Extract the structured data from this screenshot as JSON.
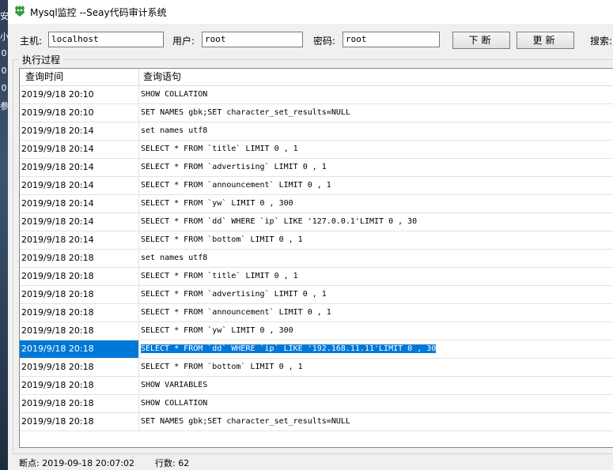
{
  "desktop": {
    "left_chars": [
      "安",
      "小",
      "0",
      "0",
      "0",
      "参"
    ]
  },
  "window": {
    "title": "Mysql监控 --Seay代码审计系统"
  },
  "connection": {
    "host_label": "主机:",
    "host_value": "localhost",
    "user_label": "用户:",
    "user_value": "root",
    "password_label": "密码:",
    "password_value": "root",
    "breakpoint_button": "下断",
    "refresh_button": "更新",
    "search_label": "搜索:"
  },
  "log": {
    "group_title": "执行过程",
    "columns": [
      "查询时间",
      "查询语句"
    ],
    "rows": [
      {
        "time": "2019/9/18 20:10",
        "query": "SHOW COLLATION"
      },
      {
        "time": "2019/9/18 20:10",
        "query": "SET NAMES gbk;SET character_set_results=NULL"
      },
      {
        "time": "2019/9/18 20:14",
        "query": "set names utf8"
      },
      {
        "time": "2019/9/18 20:14",
        "query": "SELECT * FROM  `title` LIMIT 0 , 1"
      },
      {
        "time": "2019/9/18 20:14",
        "query": "SELECT * FROM  `advertising` LIMIT 0 , 1"
      },
      {
        "time": "2019/9/18 20:14",
        "query": "SELECT * FROM  `announcement` LIMIT 0 , 1"
      },
      {
        "time": "2019/9/18 20:14",
        "query": "SELECT * FROM  `yw` LIMIT 0 , 300"
      },
      {
        "time": "2019/9/18 20:14",
        "query": "SELECT * FROM  `dd` WHERE  `ip` LIKE  '127.0.0.1'LIMIT 0 , 30"
      },
      {
        "time": "2019/9/18 20:14",
        "query": "SELECT * FROM  `bottom` LIMIT 0 , 1"
      },
      {
        "time": "2019/9/18 20:18",
        "query": "set names utf8"
      },
      {
        "time": "2019/9/18 20:18",
        "query": "SELECT * FROM  `title` LIMIT 0 , 1"
      },
      {
        "time": "2019/9/18 20:18",
        "query": "SELECT * FROM  `advertising` LIMIT 0 , 1"
      },
      {
        "time": "2019/9/18 20:18",
        "query": "SELECT * FROM  `announcement` LIMIT 0 , 1"
      },
      {
        "time": "2019/9/18 20:18",
        "query": "SELECT * FROM  `yw` LIMIT 0 , 300"
      },
      {
        "time": "2019/9/18 20:18",
        "query": "SELECT * FROM  `dd` WHERE  `ip` LIKE  '192.168.11.11'LIMIT 0 , 30",
        "selected": true
      },
      {
        "time": "2019/9/18 20:18",
        "query": "SELECT * FROM  `bottom` LIMIT 0 , 1"
      },
      {
        "time": "2019/9/18 20:18",
        "query": "SHOW VARIABLES"
      },
      {
        "time": "2019/9/18 20:18",
        "query": "SHOW COLLATION"
      },
      {
        "time": "2019/9/18 20:18",
        "query": "SET NAMES gbk;SET character_set_results=NULL"
      }
    ]
  },
  "status": {
    "breakpoint": "断点: 2019-09-18 20:07:02",
    "row_count": "行数: 62"
  },
  "colors": {
    "selection": "#0078d7",
    "icon_green": "#2e9e3c"
  }
}
